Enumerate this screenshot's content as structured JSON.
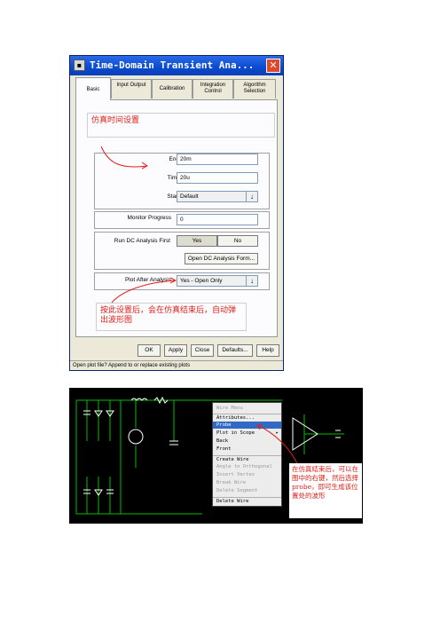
{
  "dialog": {
    "title": "Time-Domain Transient Ana...",
    "tabs": [
      {
        "label": "Basic",
        "active": true
      },
      {
        "label": "Input Output",
        "active": false
      },
      {
        "label": "Calibration",
        "active": false
      },
      {
        "label": "Integration Control",
        "active": false
      },
      {
        "label": "Algorithm Selection",
        "active": false
      }
    ],
    "annotation_time": "仿真时间设置",
    "fields": {
      "end_time": {
        "label": "End Time",
        "value": "20m"
      },
      "time_step": {
        "label": "Time Step",
        "value": "20u"
      },
      "start_time": {
        "label": "Start Time",
        "value": "Default"
      },
      "monitor_progress": {
        "label": "Monitor Progress",
        "value": "0"
      },
      "run_dc": {
        "label": "Run DC Analysis First",
        "yes": "Yes",
        "no": "No"
      },
      "open_dc_form": "Open DC Analysis Form...",
      "plot_after": {
        "label": "Plot After Analysis",
        "value": "Yes - Open Only"
      }
    },
    "annotation_plot": "按此设置后，会在仿真结束后，自动弹出波形图",
    "buttons": {
      "ok": "OK",
      "apply": "Apply",
      "close": "Close",
      "defaults": "Defaults...",
      "help": "Help"
    },
    "status": "Open plot file? Append to or replace existing plots"
  },
  "schematic": {
    "menu": {
      "title": "Wire Menu",
      "items": [
        {
          "label": "Attributes...",
          "state": "normal"
        },
        {
          "label": "Probe",
          "state": "selected"
        },
        {
          "label": "Plot in Scope",
          "state": "normal",
          "submenu": true
        },
        {
          "label": "Back",
          "state": "normal"
        },
        {
          "label": "Front",
          "state": "normal"
        },
        {
          "label": "Create Wire",
          "state": "normal"
        },
        {
          "label": "Angle to Orthogonal",
          "state": "disabled"
        },
        {
          "label": "Insert Vertex",
          "state": "disabled"
        },
        {
          "label": "Break Wire",
          "state": "disabled"
        },
        {
          "label": "Delete Segment",
          "state": "disabled"
        },
        {
          "label": "Delete Wire",
          "state": "normal"
        }
      ]
    },
    "annotation": "在仿真结束后，可以在图中的右键，然后选择probe，即可生成该位置处的波形"
  },
  "colors": {
    "annotation_red": "#e0201a",
    "schematic_bg": "#000000",
    "wire_green": "#00c000",
    "titlebar_blue": "#0a4ad0"
  }
}
